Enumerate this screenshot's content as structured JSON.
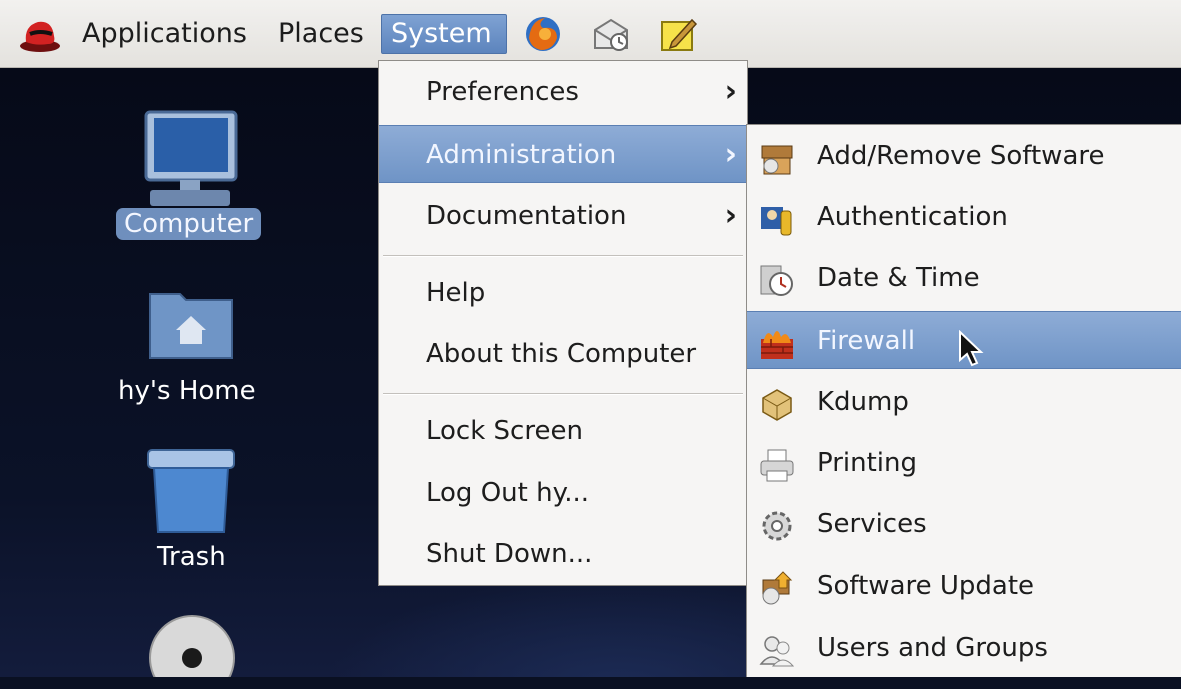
{
  "panel": {
    "applications_label": "Applications",
    "places_label": "Places",
    "system_label": "System",
    "launchers": [
      "firefox-icon",
      "mail-icon",
      "notes-icon"
    ]
  },
  "desktop": {
    "icons": [
      {
        "label": "Computer",
        "icon": "computer-icon",
        "selected": true
      },
      {
        "label": "hy's Home",
        "icon": "home-folder-icon"
      },
      {
        "label": "Trash",
        "icon": "trash-icon"
      },
      {
        "label": "",
        "icon": "dvd-icon"
      }
    ]
  },
  "system_menu": {
    "items": [
      {
        "label": "Preferences",
        "submenu": true
      },
      {
        "label": "Administration",
        "submenu": true,
        "highlighted": true
      },
      {
        "label": "Documentation",
        "submenu": true
      },
      {
        "label": "Help"
      },
      {
        "label": "About this Computer"
      },
      {
        "label": "Lock Screen"
      },
      {
        "label": "Log Out hy..."
      },
      {
        "label": "Shut Down..."
      }
    ]
  },
  "admin_menu": {
    "items": [
      {
        "label": "Add/Remove Software",
        "icon": "package-icon"
      },
      {
        "label": "Authentication",
        "icon": "authentication-icon"
      },
      {
        "label": "Date & Time",
        "icon": "clock-icon"
      },
      {
        "label": "Firewall",
        "icon": "firewall-icon",
        "highlighted": true
      },
      {
        "label": "Kdump",
        "icon": "kdump-icon"
      },
      {
        "label": "Printing",
        "icon": "printer-icon"
      },
      {
        "label": "Services",
        "icon": "services-gear-icon"
      },
      {
        "label": "Software Update",
        "icon": "software-update-icon"
      },
      {
        "label": "Users and Groups",
        "icon": "users-icon"
      }
    ]
  },
  "colors": {
    "highlight": "#7fa2d3",
    "desktop_bg": "#0a1022",
    "menu_bg": "#f6f5f4"
  }
}
